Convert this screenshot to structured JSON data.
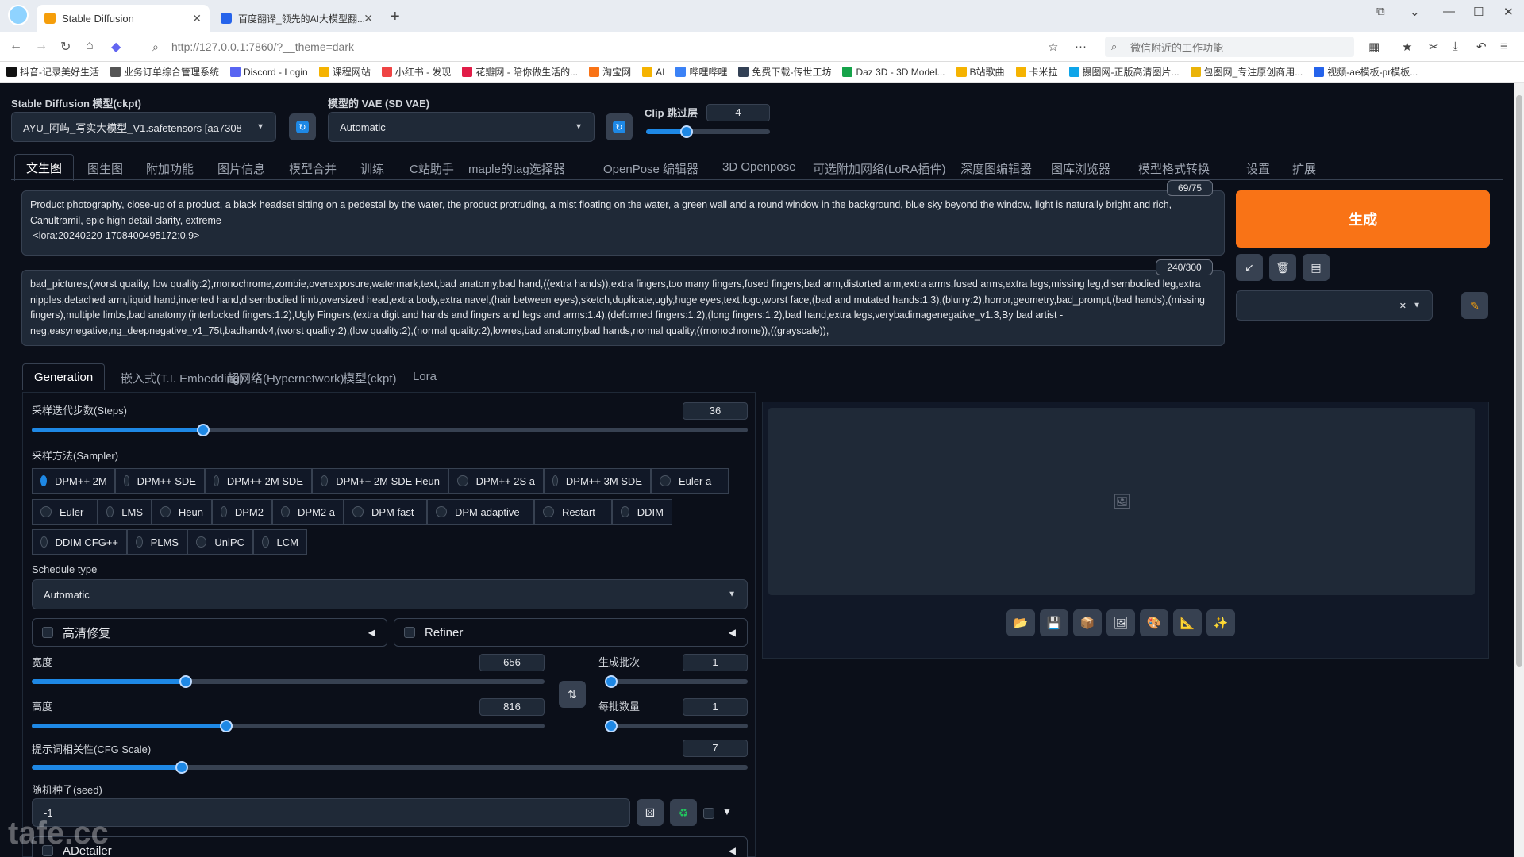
{
  "browser": {
    "tabs": [
      {
        "title": "Stable Diffusion"
      },
      {
        "title": "百度翻译_领先的AI大模型翻..."
      }
    ],
    "url": "http://127.0.0.1:7860/?__theme=dark",
    "search_placeholder": "微信附近的工作功能",
    "bookmarks": [
      "抖音-记录美好生活",
      "业务订单综合管理系统",
      "Discord - Login",
      "课程网站",
      "小红书 - 发现",
      "花瓣网 - 陪你做生活的...",
      "淘宝网",
      "AI",
      "哔哩哔哩",
      "免费下载-传世工坊",
      "Daz 3D - 3D Model...",
      "B站歌曲",
      "卡米拉",
      "摄图网-正版高清图片...",
      "包图网_专注原创商用...",
      "视频-ae模板-pr模板..."
    ]
  },
  "model": {
    "ckpt_label": "Stable Diffusion 模型(ckpt)",
    "ckpt_value": "AYU_阿屿_写实大模型_V1.safetensors [aa7308",
    "vae_label": "模型的 VAE (SD VAE)",
    "vae_value": "Automatic",
    "clip_label": "Clip 跳过层",
    "clip_value": "4",
    "clip_fraction": 0.33
  },
  "main_tabs": [
    "文生图",
    "图生图",
    "附加功能",
    "图片信息",
    "模型合并",
    "训练",
    "C站助手",
    "maple的tag选择器",
    "OpenPose 编辑器",
    "3D Openpose",
    "可选附加网络(LoRA插件)",
    "深度图编辑器",
    "图库浏览器",
    "模型格式转换",
    "设置",
    "扩展"
  ],
  "prompt": {
    "positive": "Product photography, close-up of a product, a black headset sitting on a pedestal by the water, the product protruding, a mist floating on the water, a green wall and a round window in the background, blue sky beyond the window, light is naturally bright and rich, Canultramil, epic high detail clarity, extreme\n <lora:20240220-1708400495172:0.9>",
    "positive_count": "69/75",
    "negative": "bad_pictures,(worst quality, low quality:2),monochrome,zombie,overexposure,watermark,text,bad anatomy,bad hand,((extra hands)),extra fingers,too many fingers,fused fingers,bad arm,distorted arm,extra arms,fused arms,extra legs,missing leg,disembodied leg,extra nipples,detached arm,liquid hand,inverted hand,disembodied limb,oversized head,extra body,extra navel,(hair between eyes),sketch,duplicate,ugly,huge eyes,text,logo,worst face,(bad and mutated hands:1.3),(blurry:2),horror,geometry,bad_prompt,(bad hands),(missing fingers),multiple limbs,bad anatomy,(interlocked fingers:1.2),Ugly Fingers,(extra digit and hands and fingers and legs and arms:1.4),(deformed fingers:1.2),(long fingers:1.2),bad hand,extra legs,verybadimagenegative_v1.3,By bad artist -neg,easynegative,ng_deepnegative_v1_75t,badhandv4,(worst quality:2),(low quality:2),(normal quality:2),lowres,bad anatomy,bad hands,normal quality,((monochrome)),((grayscale)),",
    "negative_count": "240/300"
  },
  "generate_label": "生成",
  "sub_tabs": [
    "Generation",
    "嵌入式(T.I. Embedding)",
    "超网络(Hypernetwork)",
    "模型(ckpt)",
    "Lora"
  ],
  "steps": {
    "label": "采样迭代步数(Steps)",
    "value": "36",
    "fraction": 0.24
  },
  "sampler": {
    "label": "采样方法(Sampler)",
    "options": [
      "DPM++ 2M",
      "DPM++ SDE",
      "DPM++ 2M SDE",
      "DPM++ 2M SDE Heun",
      "DPM++ 2S a",
      "DPM++ 3M SDE",
      "Euler a",
      "Euler",
      "LMS",
      "Heun",
      "DPM2",
      "DPM2 a",
      "DPM fast",
      "DPM adaptive",
      "Restart",
      "DDIM",
      "DDIM CFG++",
      "PLMS",
      "UniPC",
      "LCM"
    ],
    "selected": "DPM++ 2M"
  },
  "schedule": {
    "label": "Schedule type",
    "value": "Automatic"
  },
  "hires_label": "高清修复",
  "refiner_label": "Refiner",
  "width": {
    "label": "宽度",
    "value": "656",
    "fraction": 0.3
  },
  "height": {
    "label": "高度",
    "value": "816",
    "fraction": 0.38
  },
  "batch_count": {
    "label": "生成批次",
    "value": "1",
    "fraction": 0.0
  },
  "batch_size": {
    "label": "每批数量",
    "value": "1",
    "fraction": 0.0
  },
  "cfg": {
    "label": "提示词相关性(CFG Scale)",
    "value": "7",
    "fraction": 0.21
  },
  "seed": {
    "label": "随机种子(seed)",
    "value": "-1"
  },
  "adetailer_label": "ADetailer",
  "watermark": "tafe.cc"
}
